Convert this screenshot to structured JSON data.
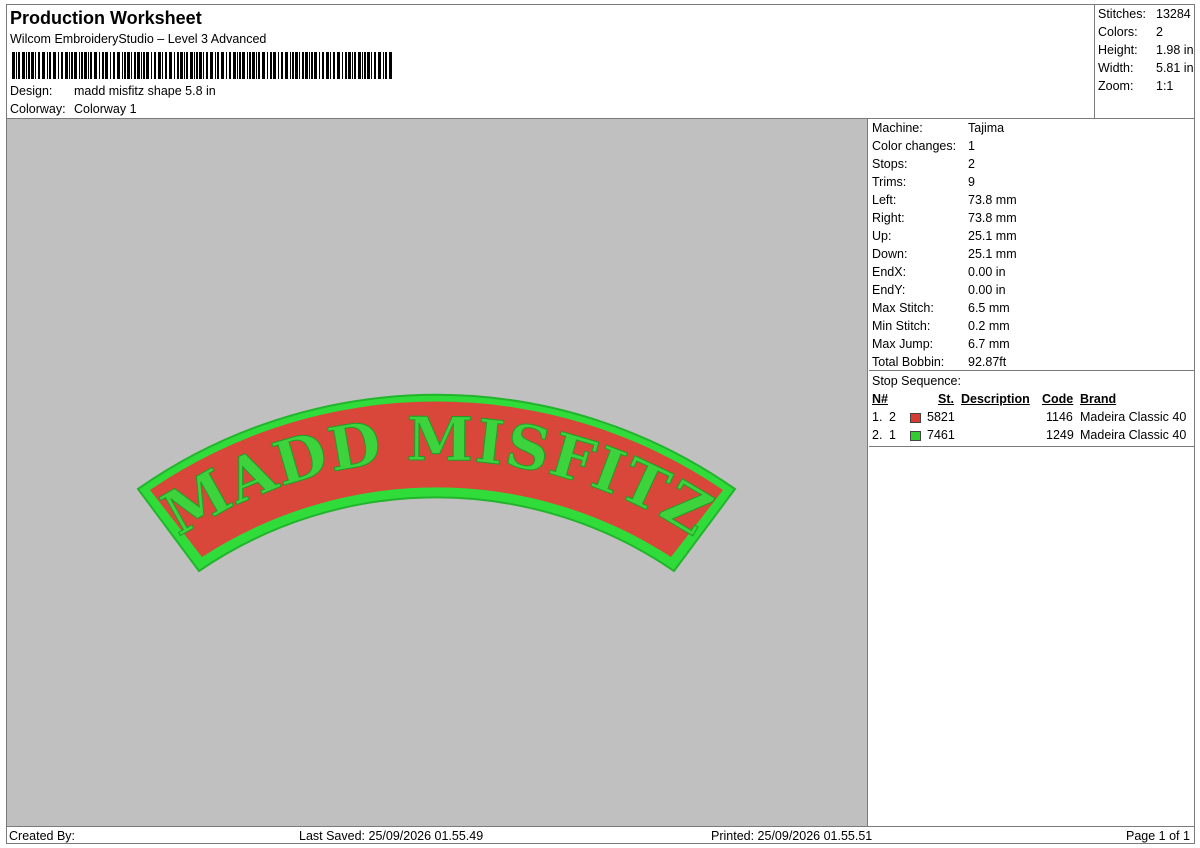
{
  "header": {
    "title": "Production Worksheet",
    "subtitle": "Wilcom EmbroideryStudio – Level 3 Advanced",
    "design_label": "Design:",
    "design_value": "madd misfitz shape 5.8 in",
    "colorway_label": "Colorway:",
    "colorway_value": "Colorway 1"
  },
  "summary": [
    {
      "label": "Stitches:",
      "value": "13284"
    },
    {
      "label": "Colors:",
      "value": "2"
    },
    {
      "label": "Height:",
      "value": "1.98 in"
    },
    {
      "label": "Width:",
      "value": "5.81 in"
    },
    {
      "label": "Zoom:",
      "value": "1:1"
    }
  ],
  "machine_info": [
    {
      "label": "Machine:",
      "value": "Tajima"
    },
    {
      "label": "Color changes:",
      "value": "1"
    },
    {
      "label": "Stops:",
      "value": "2"
    },
    {
      "label": "Trims:",
      "value": "9"
    },
    {
      "label": "Left:",
      "value": "73.8 mm"
    },
    {
      "label": "Right:",
      "value": "73.8 mm"
    },
    {
      "label": "Up:",
      "value": "25.1 mm"
    },
    {
      "label": "Down:",
      "value": "25.1 mm"
    },
    {
      "label": "EndX:",
      "value": "0.00 in"
    },
    {
      "label": "EndY:",
      "value": "0.00 in"
    },
    {
      "label": "Max Stitch:",
      "value": "6.5 mm"
    },
    {
      "label": "Min Stitch:",
      "value": "0.2 mm"
    },
    {
      "label": "Max Jump:",
      "value": "6.7 mm"
    },
    {
      "label": "Total Bobbin:",
      "value": "92.87ft"
    }
  ],
  "stop_sequence": {
    "title": "Stop Sequence:",
    "columns": {
      "n": "N#",
      "st": "St.",
      "description": "Description",
      "code": "Code",
      "brand": "Brand"
    },
    "rows": [
      {
        "index": "1.",
        "n": "2",
        "color": "#d83a34",
        "st": "5821",
        "description": "",
        "code": "1146",
        "brand": "Madeira Classic 40"
      },
      {
        "index": "2.",
        "n": "1",
        "color": "#33cc33",
        "st": "7461",
        "description": "",
        "code": "1249",
        "brand": "Madeira Classic 40"
      }
    ]
  },
  "design_preview": {
    "text": "MADD MISFITZ",
    "fill_color": "#d8473a",
    "border_color": "#2fdc3a",
    "letter_color": "#3dd33d",
    "background": "#c0c0c0"
  },
  "footer": {
    "created_by": "Created By:",
    "last_saved": "Last Saved: 25/09/2026 01.55.49",
    "printed": "Printed: 25/09/2026 01.55.51",
    "page": "Page 1 of 1"
  }
}
